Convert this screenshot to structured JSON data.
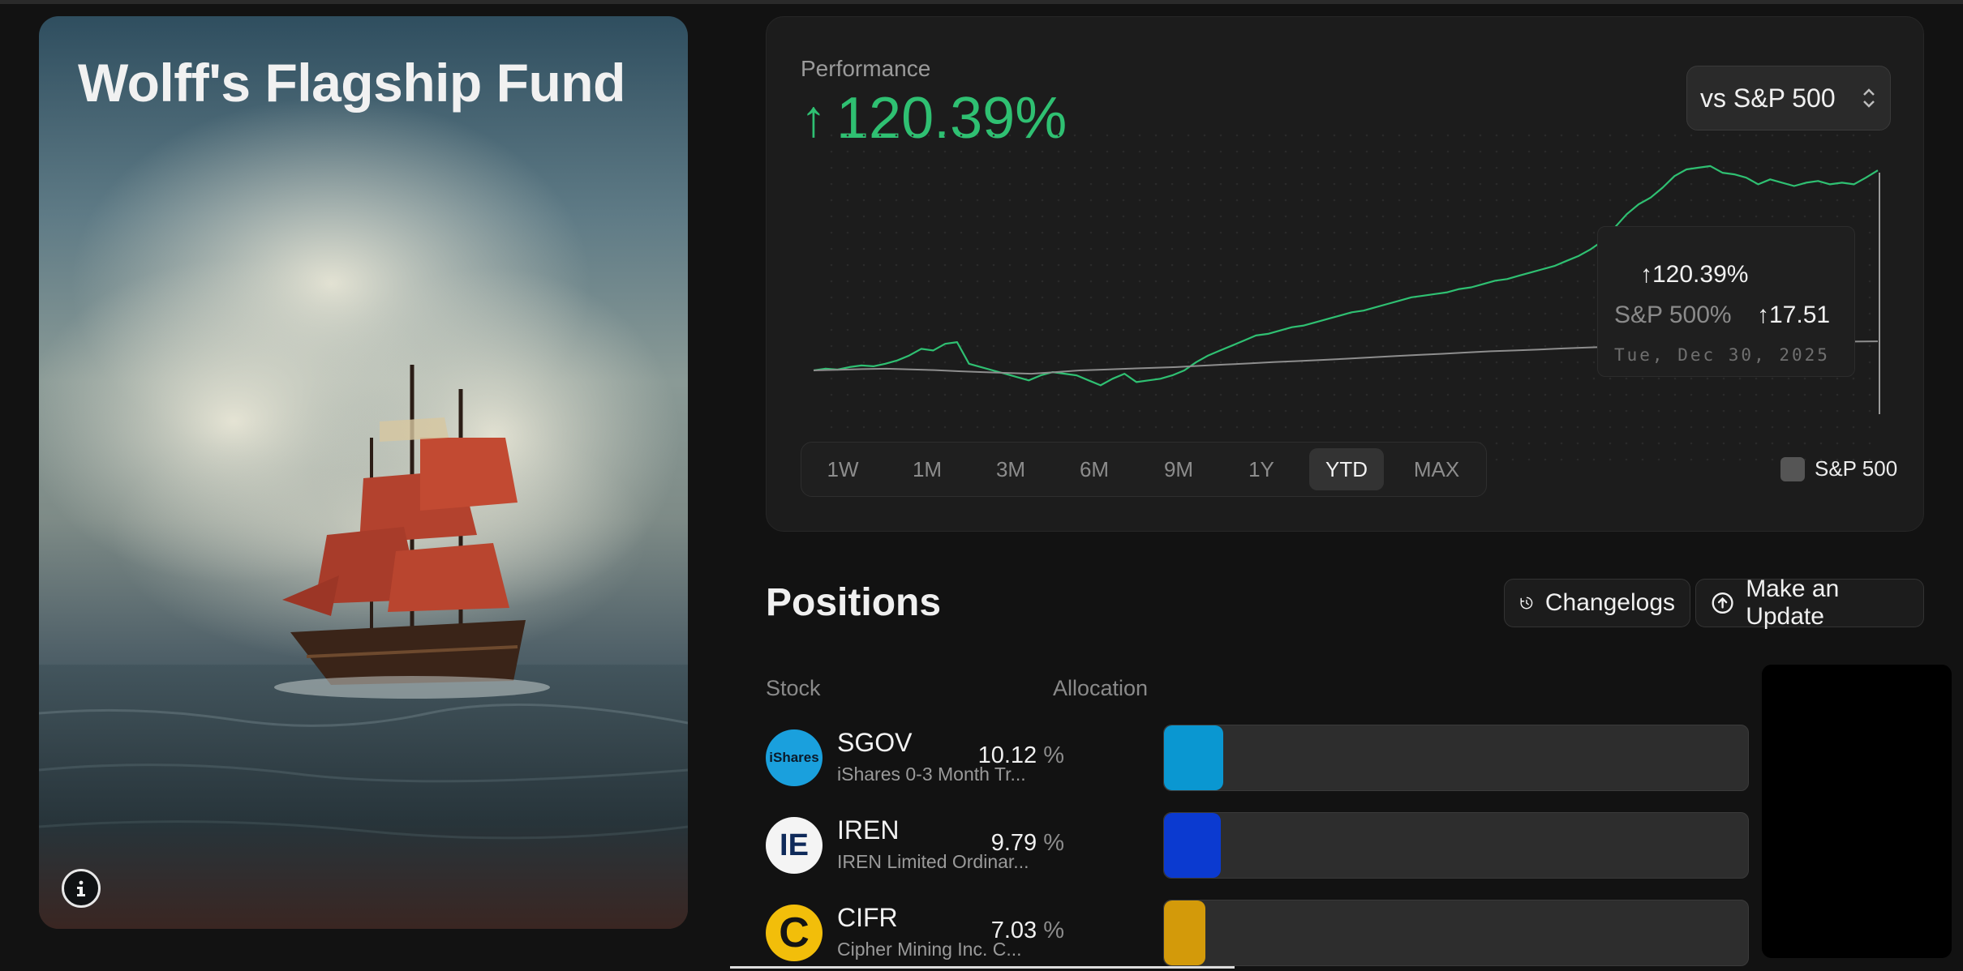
{
  "fund": {
    "title": "Wolff's Flagship Fund",
    "info_icon": "info-icon"
  },
  "performance": {
    "label": "Performance",
    "arrow": "↑",
    "value": "120.39%",
    "compare_selected": "vs S&P 500",
    "accent_color": "#2fc072",
    "tooltip": {
      "fund_value": "↑120.39%",
      "sp_label": "S&P 500%",
      "sp_value": "↑17.51",
      "date": "Tue, Dec 30, 2025"
    },
    "ranges": [
      {
        "label": "1W",
        "active": false
      },
      {
        "label": "1M",
        "active": false
      },
      {
        "label": "3M",
        "active": false
      },
      {
        "label": "6M",
        "active": false
      },
      {
        "label": "9M",
        "active": false
      },
      {
        "label": "1Y",
        "active": false
      },
      {
        "label": "YTD",
        "active": true
      },
      {
        "label": "MAX",
        "active": false
      }
    ],
    "legend_label": "S&P 500"
  },
  "chart_data": {
    "type": "line",
    "series": [
      {
        "name": "",
        "color": "#2fc072",
        "values": [
          0,
          1,
          0.5,
          2,
          3,
          2.5,
          4,
          6,
          9,
          13,
          12,
          16,
          17,
          4,
          2,
          0,
          -2,
          -4,
          -6,
          -3,
          -1,
          -2,
          -3,
          -6,
          -9,
          -5,
          -2,
          -7,
          -6,
          -5,
          -3,
          0,
          5,
          9,
          12,
          15,
          18,
          21,
          22,
          24,
          26,
          27,
          29,
          31,
          33,
          35,
          36,
          38,
          40,
          42,
          44,
          45,
          46,
          47,
          49,
          50,
          52,
          54,
          55,
          57,
          59,
          61,
          63,
          66,
          69,
          73,
          78,
          86,
          94,
          100,
          104,
          110,
          117,
          121,
          122,
          123,
          119,
          118,
          116,
          112,
          115,
          113,
          111,
          113,
          114,
          112,
          113,
          112,
          116,
          120.39
        ]
      },
      {
        "name": "S&P 500",
        "color": "#8e8e8e",
        "values": [
          0,
          0.4,
          0.8,
          1,
          0.6,
          0.2,
          -0.5,
          -1,
          -1.5,
          -2,
          -1,
          0,
          0.5,
          1,
          1.5,
          2,
          2.8,
          3.5,
          4.2,
          5,
          5.6,
          6.3,
          7,
          7.8,
          8.6,
          9.3,
          10,
          10.8,
          11.5,
          12,
          12.6,
          13.2,
          13.8,
          14.3,
          14.8,
          15.2,
          15.6,
          16,
          16.3,
          16.5,
          16.8,
          17,
          17.2,
          17.35,
          17.51
        ]
      }
    ]
  },
  "positions": {
    "title": "Positions",
    "changelogs_label": "Changelogs",
    "update_label": "Make an Update",
    "col_stock": "Stock",
    "col_allocation": "Allocation",
    "rows": [
      {
        "ticker": "SGOV",
        "company": "iShares 0-3 Month Tr...",
        "allocation": "10.12",
        "unit": "%",
        "fill_percent": 10.12,
        "color": "#0a97d1",
        "logo_text": "iShares",
        "logo_bg": "#1aa0dd",
        "logo_fg": "#0b1a2a"
      },
      {
        "ticker": "IREN",
        "company": "IREN Limited Ordinar...",
        "allocation": "9.79",
        "unit": "%",
        "fill_percent": 9.79,
        "color": "#0b3ad0",
        "logo_text": "IE",
        "logo_bg": "#f4f4f4",
        "logo_fg": "#0f2a5a"
      },
      {
        "ticker": "CIFR",
        "company": "Cipher Mining Inc. C...",
        "allocation": "7.03",
        "unit": "%",
        "fill_percent": 7.03,
        "color": "#d39a0a",
        "logo_text": "C",
        "logo_bg": "#f2be0a",
        "logo_fg": "#141414"
      }
    ]
  }
}
